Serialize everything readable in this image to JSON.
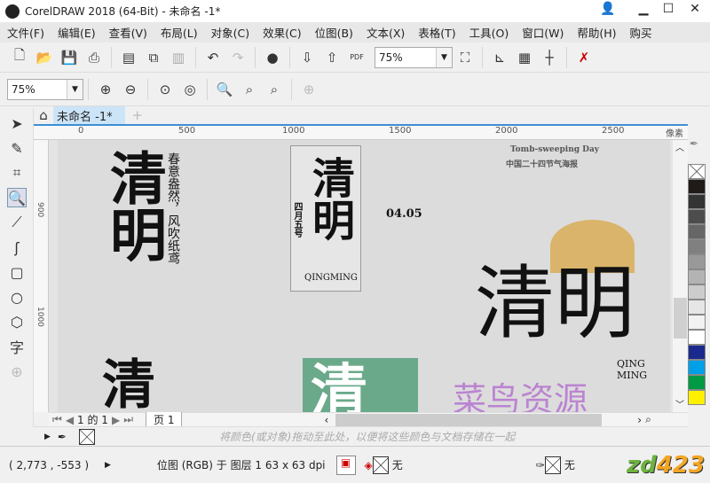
{
  "app": {
    "title": "CorelDRAW 2018 (64-Bit) - 未命名 -1*"
  },
  "menu": [
    "文件(F)",
    "编辑(E)",
    "查看(V)",
    "布局(L)",
    "对象(C)",
    "效果(C)",
    "位图(B)",
    "文本(X)",
    "表格(T)",
    "工具(O)",
    "窗口(W)",
    "帮助(H)",
    "购买"
  ],
  "toolbar": {
    "zoom_value": "75%",
    "pdf_label": "PDF"
  },
  "zoombar": {
    "zoom_value": "75%"
  },
  "tabs": [
    {
      "label": "未命名 -1*"
    }
  ],
  "ruler": {
    "h_ticks": [
      "0",
      "500",
      "1000",
      "1500",
      "2000",
      "2500"
    ],
    "unit": "像素",
    "v_ticks": [
      "900",
      "1000"
    ]
  },
  "canvas": {
    "poster_texts": [
      "清明",
      "春意盎然，风吹纸鸢",
      "清明",
      "四月五号",
      "04.05",
      "QINGMING",
      "Tomb-sweeping Day",
      "中国二十四节气海报",
      "清明",
      "QING MING",
      "清",
      "清"
    ],
    "watermark": "菜鸟资源"
  },
  "palette_colors": [
    "#201a18",
    "#333333",
    "#4d4d4d",
    "#666666",
    "#808080",
    "#999999",
    "#b3b3b3",
    "#cccccc",
    "#e6e6e6",
    "#f2f2f2",
    "#ffffff",
    "#1a2a8c",
    "#00a0e9",
    "#009944",
    "#fff000"
  ],
  "pager": {
    "page_info": "1 的 1",
    "page_tab": "页 1"
  },
  "docpalette": {
    "hint": "将颜色(或对象)拖动至此处，以便将这些颜色与文档存储在一起"
  },
  "status": {
    "coords": "( 2,773 , -553  )",
    "object_info": "位图 (RGB) 于 图层 1 63 x 63 dpi",
    "fill_label": "无",
    "outline_label": "无"
  },
  "brand_watermark": "zd423"
}
